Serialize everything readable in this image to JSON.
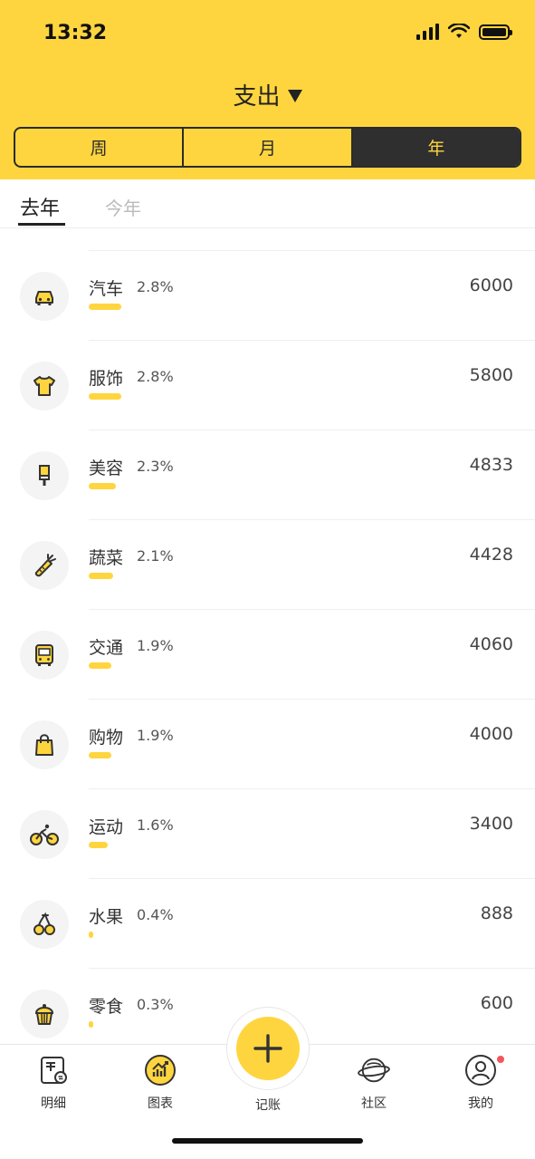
{
  "status": {
    "time": "13:32"
  },
  "header": {
    "title": "支出",
    "segments": [
      "周",
      "月",
      "年"
    ],
    "active_segment": "年"
  },
  "tabs": {
    "active": "去年",
    "inactive": "今年"
  },
  "categories": [
    {
      "name": "汽车",
      "percent": "2.8%",
      "amount": "6000",
      "icon": "car-icon",
      "share": 2.8
    },
    {
      "name": "服饰",
      "percent": "2.8%",
      "amount": "5800",
      "icon": "tshirt-icon",
      "share": 2.8
    },
    {
      "name": "美容",
      "percent": "2.3%",
      "amount": "4833",
      "icon": "makeup-brush-icon",
      "share": 2.3
    },
    {
      "name": "蔬菜",
      "percent": "2.1%",
      "amount": "4428",
      "icon": "carrot-icon",
      "share": 2.1
    },
    {
      "name": "交通",
      "percent": "1.9%",
      "amount": "4060",
      "icon": "bus-icon",
      "share": 1.9
    },
    {
      "name": "购物",
      "percent": "1.9%",
      "amount": "4000",
      "icon": "shopping-bag-icon",
      "share": 1.9
    },
    {
      "name": "运动",
      "percent": "1.6%",
      "amount": "3400",
      "icon": "bicycle-icon",
      "share": 1.6
    },
    {
      "name": "水果",
      "percent": "0.4%",
      "amount": "888",
      "icon": "cherry-icon",
      "share": 0.4
    },
    {
      "name": "零食",
      "percent": "0.3%",
      "amount": "600",
      "icon": "cupcake-icon",
      "share": 0.3
    }
  ],
  "tabbar": {
    "detail": "明细",
    "chart": "图表",
    "add": "记账",
    "community": "社区",
    "mine": "我的"
  },
  "colors": {
    "accent": "#FFD53F",
    "dark": "#2f2f2f",
    "badge": "#F2555A"
  }
}
